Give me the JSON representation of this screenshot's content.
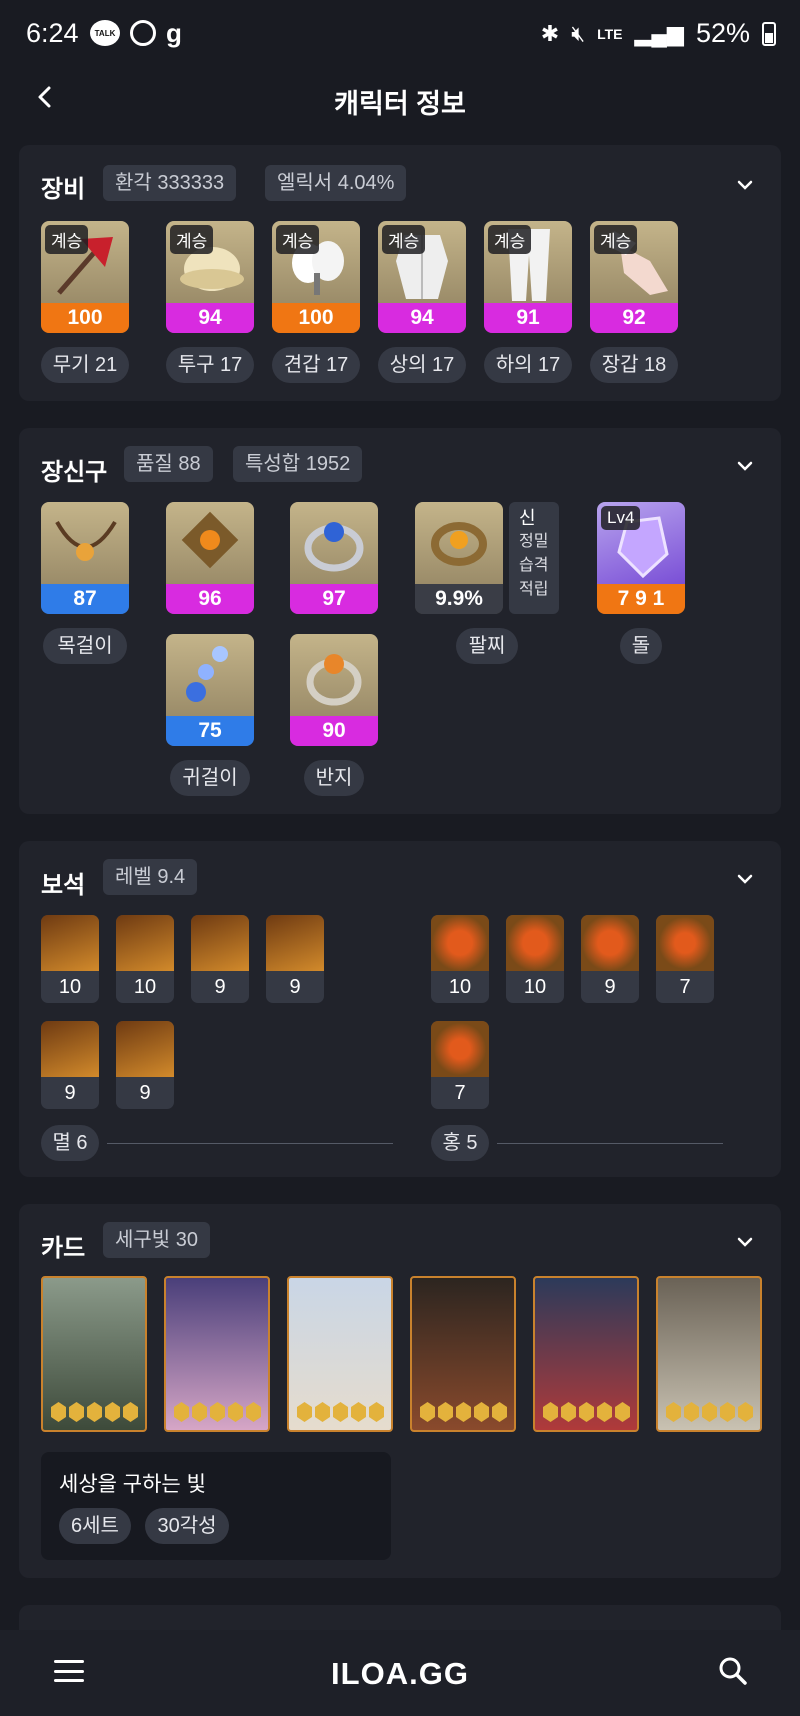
{
  "status": {
    "time": "6:24",
    "battery": "52%",
    "talk": "TALK",
    "lte": "LTE"
  },
  "header": {
    "title": "캐릭터 정보"
  },
  "equipment": {
    "title": "장비",
    "chips": [
      "환각 333333",
      "엘릭서 4.04%"
    ],
    "items": [
      {
        "tag": "계승",
        "value": "100",
        "grade": "orange",
        "label": "무기 21"
      },
      {
        "tag": "계승",
        "value": "94",
        "grade": "magenta",
        "label": "투구 17"
      },
      {
        "tag": "계승",
        "value": "100",
        "grade": "orange",
        "label": "견갑 17"
      },
      {
        "tag": "계승",
        "value": "94",
        "grade": "magenta",
        "label": "상의 17"
      },
      {
        "tag": "계승",
        "value": "91",
        "grade": "magenta",
        "label": "하의 17"
      },
      {
        "tag": "계승",
        "value": "92",
        "grade": "magenta",
        "label": "장갑 18"
      }
    ]
  },
  "accessories": {
    "title": "장신구",
    "chips": [
      "품질 88",
      "특성합 1952"
    ],
    "necklace": {
      "value": "87",
      "label": "목걸이"
    },
    "earrings": [
      {
        "value": "96"
      },
      {
        "value": "75"
      }
    ],
    "earring_label": "귀걸이",
    "rings": [
      {
        "value": "97"
      },
      {
        "value": "90"
      }
    ],
    "ring_label": "반지",
    "bracelet": {
      "value": "9.9%",
      "label": "팔찌",
      "effects": [
        "신",
        "정밀",
        "습격",
        "적립"
      ]
    },
    "stone": {
      "tag": "Lv4",
      "value": "7 9 1",
      "label": "돌"
    }
  },
  "gems": {
    "title": "보석",
    "chips": [
      "레벨 9.4"
    ],
    "left": [
      "10",
      "10",
      "9",
      "9",
      "9",
      "9"
    ],
    "right": [
      "10",
      "10",
      "9",
      "7",
      "7"
    ],
    "left_label": "멸 6",
    "right_label": "홍 5"
  },
  "cards": {
    "title": "카드",
    "chips": [
      "세구빛 30"
    ],
    "stars": [
      5,
      5,
      5,
      5,
      5,
      5
    ],
    "set_name": "세상을 구하는 빛",
    "set_tags": [
      "6세트",
      "30각성"
    ]
  },
  "nav": {
    "brand": "ILOA.GG"
  },
  "colors": {
    "orange": "#f07613",
    "magenta": "#d82be0",
    "blue": "#2f7ce8",
    "bg": "#191b22",
    "panel": "#21232b"
  }
}
